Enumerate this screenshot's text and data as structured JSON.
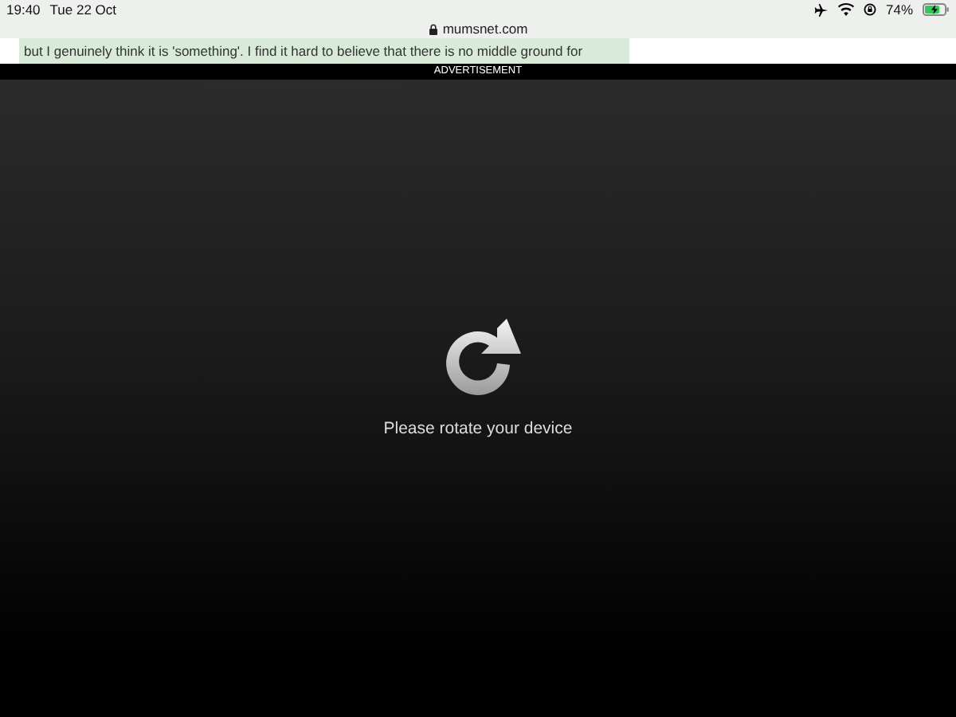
{
  "status_bar": {
    "time": "19:40",
    "date": "Tue 22 Oct",
    "battery": "74%"
  },
  "address_bar": {
    "url": "mumsnet.com"
  },
  "post": {
    "text": "but I genuinely think it is 'something'. I find it hard to believe that there is no middle ground for"
  },
  "ad_banner": {
    "label": "ADVERTISEMENT"
  },
  "rotate_overlay": {
    "message": "Please rotate your device"
  }
}
